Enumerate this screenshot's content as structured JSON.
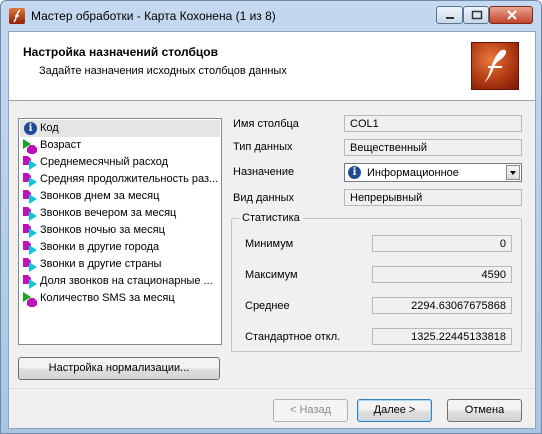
{
  "window": {
    "title": "Мастер обработки - Карта Кохонена (1 из 8)"
  },
  "header": {
    "title": "Настройка назначений столбцов",
    "subtitle": "Задайте назначения исходных столбцов данных"
  },
  "columns_list": {
    "items": [
      {
        "label": "Код",
        "icon": "info-icon",
        "selected": true
      },
      {
        "label": "Возраст",
        "icon": "input-field-icon"
      },
      {
        "label": "Среднемесячный расход",
        "icon": "input-field-icon"
      },
      {
        "label": "Средняя продолжительность раз...",
        "icon": "input-field-icon"
      },
      {
        "label": "Звонков днем за месяц",
        "icon": "input-field-icon"
      },
      {
        "label": "Звонков вечером за месяц",
        "icon": "input-field-icon"
      },
      {
        "label": "Звонков ночью за месяц",
        "icon": "input-field-icon"
      },
      {
        "label": "Звонки в другие города",
        "icon": "input-field-icon"
      },
      {
        "label": "Звонки в другие страны",
        "icon": "input-field-icon"
      },
      {
        "label": "Доля звонков на стационарные ...",
        "icon": "input-field-icon"
      },
      {
        "label": "Количество SMS за месяц",
        "icon": "input-field-icon"
      }
    ]
  },
  "properties": {
    "column_name_label": "Имя столбца",
    "column_name_value": "COL1",
    "data_type_label": "Тип данных",
    "data_type_value": "Вещественный",
    "purpose_label": "Назначение",
    "purpose_value": "Информационное",
    "data_kind_label": "Вид данных",
    "data_kind_value": "Непрерывный"
  },
  "statistics": {
    "caption": "Статистика",
    "min_label": "Минимум",
    "min_value": "0",
    "max_label": "Максимум",
    "max_value": "4590",
    "mean_label": "Среднее",
    "mean_value": "2294.63067675868",
    "std_label": "Стандартное откл.",
    "std_value": "1325.22445133818"
  },
  "buttons": {
    "normalization": "Настройка нормализации...",
    "back": "< Назад",
    "next": "Далее >",
    "cancel": "Отмена"
  },
  "colors": {
    "arrow_green": "#16a818",
    "arrow_cyan": "#14c4d8",
    "magenta": "#c010b8",
    "info_blue": "#1f4a98"
  }
}
